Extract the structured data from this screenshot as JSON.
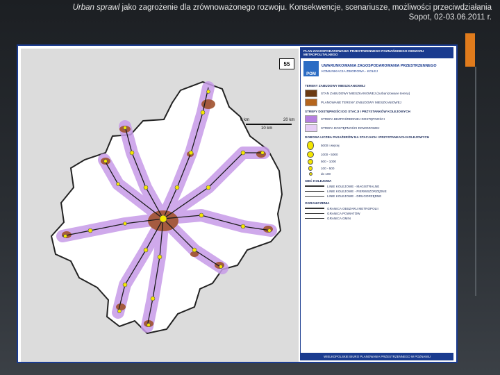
{
  "header": {
    "title_line1_italic": "Urban sprawl",
    "title_line1_rest": " jako zagrożenie dla zrównoważonego rozwoju. Konsekwencje, scenariusze, możliwości przeciwdziałania",
    "title_line2": "Sopot, 02-03.06.2011 r."
  },
  "map": {
    "number": "55",
    "scale": {
      "left": "0 km",
      "mid": "10 km",
      "right": "20 km"
    },
    "colors": {
      "corridor": "#c79be8",
      "corridor_edge": "#9b5fd0",
      "urban": "#a0522d",
      "land": "#ffffff",
      "outside": "#dcdcdc",
      "border": "#222222",
      "rail": "#1b1b1b",
      "station": "#f4e600"
    }
  },
  "legend": {
    "head": "PLAN ZAGOSPODAROWANIA PRZESTRZENNEGO POZNAŃSKIEGO OBSZARU METROPOLITALNEGO",
    "title": "UWARUNKOWANIA ZAGOSPODAROWANIA PRZESTRZENNEGO",
    "subtitle": "KOMUNIKACJA ZBIOROWA - KOLEJ",
    "logo": "POM",
    "sections": [
      {
        "name": "TERENY ZABUDOWY MIESZKANIOWEJ",
        "items": [
          {
            "label": "STAN ZABUDOWY MIESZKANIOWEJ (zurbanizowane tereny)",
            "color": "#6b3a12"
          },
          {
            "label": "PLANOWANE TERENY ZABUDOWY MIESZKANIOWEJ",
            "color": "#b5651d"
          }
        ]
      },
      {
        "name": "STREFY DOSTĘPNOŚCI DO STACJI I PRZYSTANKÓW KOLEJOWYCH",
        "items": [
          {
            "label": "STREFA BEZPOŚREDNIEJ DOSTĘPNOŚCI",
            "color": "#b67fe0"
          },
          {
            "label": "STREFA DOSTĘPNOŚCI DOWOZOWEJ",
            "color": "#e6cdf5"
          }
        ]
      },
      {
        "name": "DOBOWA LICZBA PASAŻERÓW NA STACJACH I PRZYSTANKACH KOLEJOWYCH",
        "items": [
          {
            "label": "5000 i więcej",
            "size": 9
          },
          {
            "label": "1000 - 5000",
            "size": 6
          },
          {
            "label": "500 - 1000",
            "size": 5
          },
          {
            "label": "100 - 500",
            "size": 4
          },
          {
            "label": "do 100",
            "size": 2.5
          }
        ]
      },
      {
        "name": "SIEĆ KOLEJOWA",
        "items": [
          {
            "label": "LINIE KOLEJOWE - MAGISTRALNE",
            "weight": 2
          },
          {
            "label": "LINIE KOLEJOWE - PIERWSZORZĘDNE",
            "weight": 1.4
          },
          {
            "label": "LINIE KOLEJOWE - DRUGORZĘDNE",
            "weight": 0.9
          }
        ]
      },
      {
        "name": "OGRANICZENIA",
        "items": [
          {
            "label": "GRANICA OBSZARU METROPOLII",
            "weight": 2.2
          },
          {
            "label": "GRANICA POWIATÓW",
            "weight": 0.8
          },
          {
            "label": "GRANICA GMIN",
            "weight": 0.5
          }
        ]
      }
    ],
    "footer": "WIELKOPOLSKIE BIURO PLANOWANIA PRZESTRZENNEGO W POZNANIU"
  }
}
